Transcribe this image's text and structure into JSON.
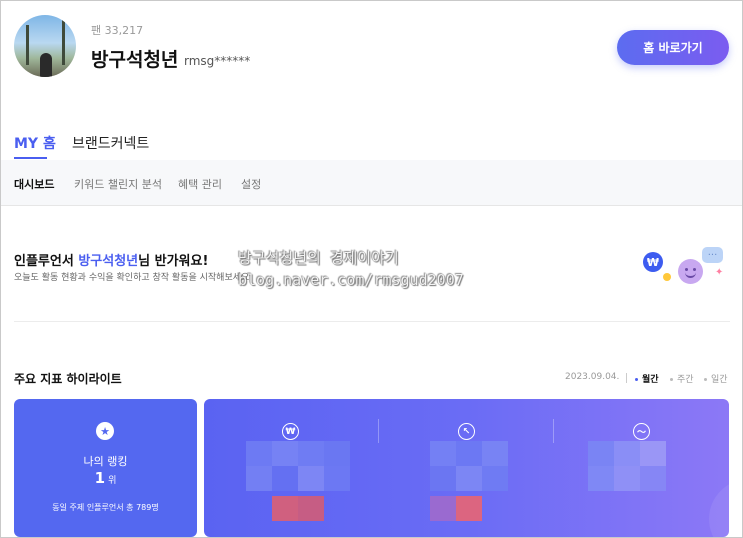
{
  "profile": {
    "fan_count": "팬 33,217",
    "nickname": "방구석청년",
    "user_id": "rmsg******",
    "home_button": "홈 바로가기"
  },
  "main_tabs": [
    "MY 홈",
    "브랜드커넥트"
  ],
  "sub_tabs": [
    "대시보드",
    "키워드 챌린지 분석",
    "혜택 관리",
    "설정"
  ],
  "welcome": {
    "prefix": "인플루언서 ",
    "name": "방구석청년",
    "suffix": "님 반가워요!",
    "subtitle": "오늘도 활동 현황과 수익을 확인하고 창작 활동을 시작해보세요!"
  },
  "watermark": {
    "line1": "방구석청년의 경제이야기",
    "line2": "blog.naver.com/rmsgud2007"
  },
  "highlights": {
    "title": "주요 지표 하이라이트",
    "date": "2023.09.04.",
    "periods": [
      "월간",
      "주간",
      "일간"
    ],
    "rank_card": {
      "label": "나의 랭킹",
      "value": "1",
      "unit": "위",
      "sub": "동일 주제 인플루언서 총 789명"
    }
  },
  "icons": {
    "badge": "₩",
    "chat": "···",
    "sparkle": "✦",
    "star": "★",
    "won": "₩",
    "cursor": "↖",
    "trend": "〜"
  },
  "colors": {
    "accent": "#4a5ef0",
    "card": "#5468f0"
  }
}
